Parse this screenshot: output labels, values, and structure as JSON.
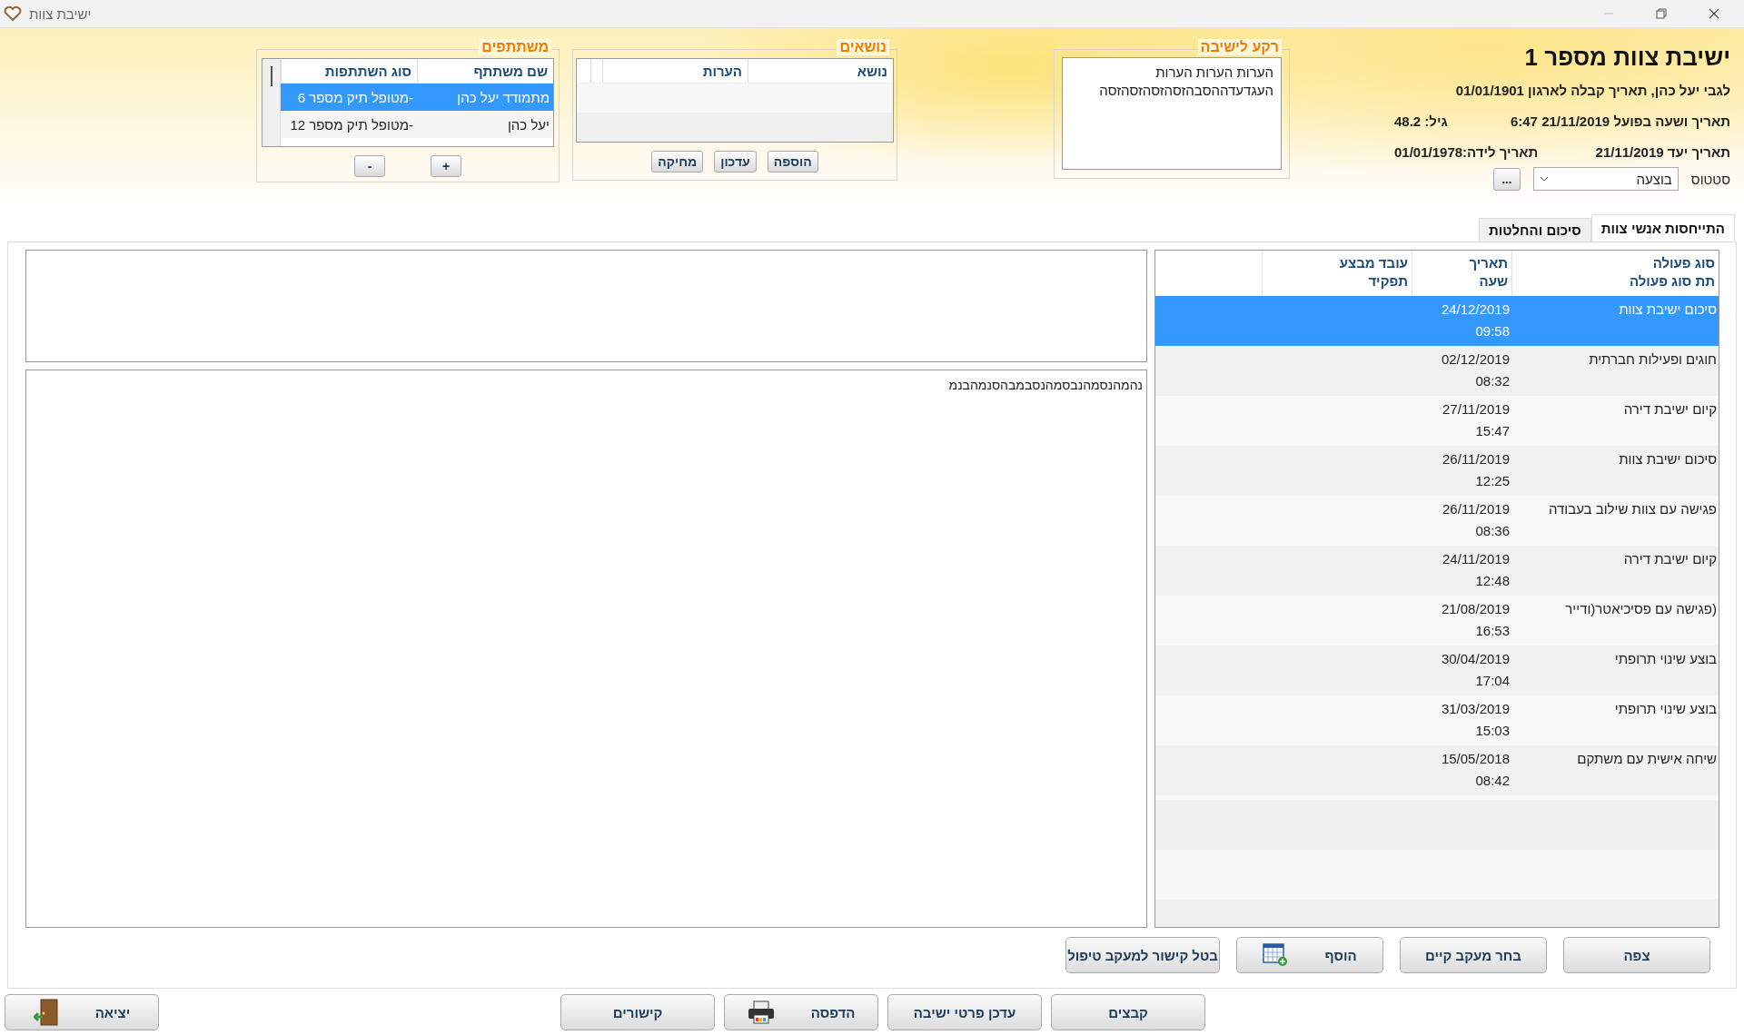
{
  "window": {
    "title": "ישיבת צוות"
  },
  "meeting": {
    "title": "ישיבת צוות מספר 1",
    "subject": "לגבי יעל כהן, תאריך קבלה לארגון 01/01/1901",
    "actual_datetime": "תאריך ושעה בפועל 21/11/2019 6:47",
    "age": "גיל: 48.2",
    "target_date": "תאריך יעד 21/11/2019",
    "birth_date": "תאריך לידה:01/01/1978",
    "status_label": "סטטוס",
    "status_value": "בוצעה",
    "more_button": "..."
  },
  "background": {
    "title": "רקע לישיבה",
    "text": "הערות הערות הערות העגדעדההסבהזסהזסהזסהזסה"
  },
  "topics": {
    "title": "נושאים",
    "columns": [
      "נושא",
      "הערות"
    ],
    "buttons": [
      "הוספה",
      "עדכון",
      "מחיקה"
    ]
  },
  "participants": {
    "title": "משתתפים",
    "columns": [
      "שם משתתף",
      "סוג השתתפות"
    ],
    "rows": [
      {
        "name": "מתמודד יעל כהן",
        "type": "-מטופל תיק מספר 6",
        "selected": true
      },
      {
        "name": "יעל כהן",
        "type": "-מטופל תיק מספר 12",
        "selected": false
      }
    ],
    "buttons": [
      "+",
      "-"
    ]
  },
  "tabs": [
    {
      "label": "התייחסות אנשי צוות",
      "selected": true
    },
    {
      "label": "סיכום והחלטות",
      "selected": false
    }
  ],
  "table": {
    "columns": [
      [
        "סוג פעולה",
        "תת סוג פעולה"
      ],
      [
        "תאריך",
        "שעה"
      ],
      [
        "עובד מבצע",
        "תפקיד"
      ]
    ],
    "rows": [
      {
        "action": "סיכום ישיבת צוות",
        "date": "24/12/2019",
        "time": "09:58",
        "selected": true
      },
      {
        "action": "חוגים ופעילות חברתית",
        "date": "02/12/2019",
        "time": "08:32",
        "selected": false
      },
      {
        "action": "קיום ישיבת דירה",
        "date": "27/11/2019",
        "time": "15:47",
        "selected": false
      },
      {
        "action": "סיכום ישיבת צוות",
        "date": "26/11/2019",
        "time": "12:25",
        "selected": false
      },
      {
        "action": "פגישה עם צוות שילוב בעבודה",
        "date": "26/11/2019",
        "time": "08:36",
        "selected": false
      },
      {
        "action": "קיום ישיבת דירה",
        "date": "24/11/2019",
        "time": "12:48",
        "selected": false
      },
      {
        "action": "(פגישה עם פסיכיאטר(ודייר",
        "date": "21/08/2019",
        "time": "16:53",
        "selected": false
      },
      {
        "action": "בוצע שינוי תרופתי",
        "date": "30/04/2019",
        "time": "17:04",
        "selected": false
      },
      {
        "action": "בוצע שינוי תרופתי",
        "date": "31/03/2019",
        "time": "15:03",
        "selected": false
      },
      {
        "action": "שיחה אישית עם משתקם",
        "date": "15/05/2018",
        "time": "08:42",
        "selected": false
      }
    ]
  },
  "notes": {
    "bottom": "נהמהנסמהנבסמהנסבמבהסנמהבנמ"
  },
  "actions": [
    {
      "label": "צפה",
      "kind": "plain"
    },
    {
      "label": "בחר מעקב קיים",
      "kind": "plain"
    },
    {
      "label": "הוסף",
      "kind": "calendar"
    },
    {
      "label": "בטל קישור למעקב טיפול",
      "kind": "plain"
    }
  ],
  "footer": [
    {
      "label": "קבצים",
      "kind": "plain"
    },
    {
      "label": "עדכן פרטי ישיבה",
      "kind": "plain"
    },
    {
      "label": "הדפסה",
      "kind": "printer"
    },
    {
      "label": "קישורים",
      "kind": "plain"
    },
    {
      "label": "יציאה",
      "kind": "exit"
    }
  ]
}
